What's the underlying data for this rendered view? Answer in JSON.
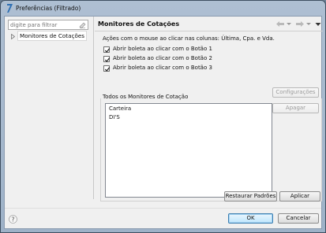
{
  "window": {
    "title": "Preferências (Filtrado)"
  },
  "filter": {
    "placeholder": "digite para filtrar"
  },
  "tree": {
    "items": [
      {
        "label": "Monitores de Cotações",
        "selected": true
      }
    ]
  },
  "page": {
    "title": "Monitores de Cotações",
    "mouse_actions_description": "Ações com o mouse ao clicar nas colunas: Última, Cpa. e Vda.",
    "checkboxes": [
      {
        "label": "Abrir boleta ao clicar com o Botão 1",
        "checked": true
      },
      {
        "label": "Abrir boleta ao clicar com o Botão 2",
        "checked": true
      },
      {
        "label": "Abrir boleta ao clicar com o Botão 3",
        "checked": true
      }
    ],
    "monitors_group_title": "Todos os Monitores de Cotação",
    "monitors": [
      "Carteira",
      "DI'S"
    ],
    "configure_button": "Configurações",
    "delete_button": "Apagar",
    "restore_defaults_button": "Restaurar Padrões",
    "apply_button": "Aplicar"
  },
  "dialog": {
    "ok_button": "OK",
    "cancel_button": "Cancelar"
  },
  "icons": {
    "app": "app-logo-icon",
    "clear": "clear-filter-icon",
    "tree_arrow": "tree-expand-icon",
    "back": "back-arrow-icon",
    "forward": "forward-arrow-icon",
    "menu": "view-menu-icon",
    "help": "help-icon"
  },
  "colors": {
    "titlebar": "#aebfd2",
    "default_button": "#3c7fb1"
  }
}
